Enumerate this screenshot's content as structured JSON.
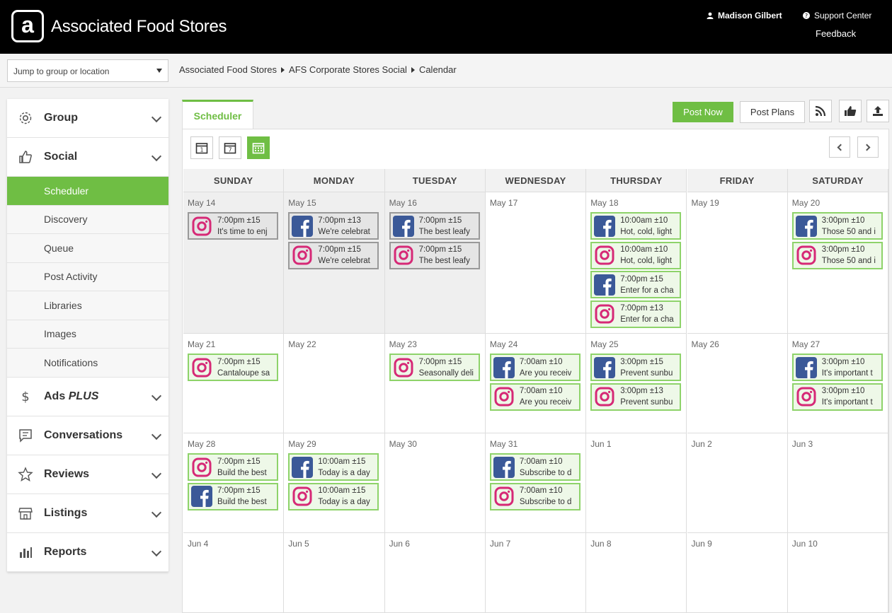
{
  "header": {
    "logo_letter": "a",
    "brand": "Associated Food Stores",
    "user_name": "Madison Gilbert",
    "support_label": "Support Center",
    "feedback_label": "Feedback"
  },
  "location_select": {
    "value": "Jump to group or location"
  },
  "breadcrumb": [
    "Associated Food Stores",
    "AFS Corporate Stores Social",
    "Calendar"
  ],
  "sidebar": {
    "group": "Group",
    "social": "Social",
    "social_items": [
      "Scheduler",
      "Discovery",
      "Queue",
      "Post Activity",
      "Libraries",
      "Images",
      "Notifications"
    ],
    "ads": "Ads",
    "ads_suffix": "PLUS",
    "conversations": "Conversations",
    "reviews": "Reviews",
    "listings": "Listings",
    "reports": "Reports"
  },
  "toolbar": {
    "tab_scheduler": "Scheduler",
    "post_now": "Post Now",
    "post_plans": "Post Plans",
    "view_day_num": "1",
    "view_week_num": "7"
  },
  "colors": {
    "accent": "#6fbe44",
    "facebook": "#3b5998",
    "instagram": "#d62976"
  },
  "calendar": {
    "days": [
      "SUNDAY",
      "MONDAY",
      "TUESDAY",
      "WEDNESDAY",
      "THURSDAY",
      "FRIDAY",
      "SATURDAY"
    ],
    "weeks": [
      [
        "May 14",
        "May 15",
        "May 16",
        "May 17",
        "May 18",
        "May 19",
        "May 20"
      ],
      [
        "May 21",
        "May 22",
        "May 23",
        "May 24",
        "May 25",
        "May 26",
        "May 27"
      ],
      [
        "May 28",
        "May 29",
        "May 30",
        "May 31",
        "Jun 1",
        "Jun 2",
        "Jun 3"
      ],
      [
        "Jun 4",
        "Jun 5",
        "Jun 6",
        "Jun 7",
        "Jun 8",
        "Jun 9",
        "Jun 10"
      ]
    ],
    "posts": [
      {
        "week": 0,
        "day": 0,
        "slot": 0,
        "network": "instagram",
        "time": "7:00pm ±15",
        "text": "It's time to enj",
        "past": true
      },
      {
        "week": 0,
        "day": 1,
        "slot": 0,
        "network": "facebook",
        "time": "7:00pm ±13",
        "text": "We're celebrat",
        "past": true
      },
      {
        "week": 0,
        "day": 1,
        "slot": 1,
        "network": "instagram",
        "time": "7:00pm ±15",
        "text": "We're celebrat",
        "past": true
      },
      {
        "week": 0,
        "day": 2,
        "slot": 0,
        "network": "facebook",
        "time": "7:00pm ±15",
        "text": "The best leafy",
        "past": true
      },
      {
        "week": 0,
        "day": 2,
        "slot": 1,
        "network": "instagram",
        "time": "7:00pm ±15",
        "text": "The best leafy",
        "past": true
      },
      {
        "week": 0,
        "day": 4,
        "slot": 0,
        "network": "facebook",
        "time": "10:00am ±10",
        "text": "Hot, cold, light",
        "past": false
      },
      {
        "week": 0,
        "day": 4,
        "slot": 1,
        "network": "instagram",
        "time": "10:00am ±10",
        "text": "Hot, cold, light",
        "past": false
      },
      {
        "week": 0,
        "day": 4,
        "slot": 2,
        "network": "facebook",
        "time": "7:00pm ±15",
        "text": "Enter for a cha",
        "past": false
      },
      {
        "week": 0,
        "day": 4,
        "slot": 3,
        "network": "instagram",
        "time": "7:00pm ±13",
        "text": "Enter for a cha",
        "past": false
      },
      {
        "week": 0,
        "day": 6,
        "slot": 0,
        "network": "facebook",
        "time": "3:00pm ±10",
        "text": "Those 50 and i",
        "past": false
      },
      {
        "week": 0,
        "day": 6,
        "slot": 1,
        "network": "instagram",
        "time": "3:00pm ±10",
        "text": "Those 50 and i",
        "past": false
      },
      {
        "week": 1,
        "day": 0,
        "slot": 0,
        "network": "instagram",
        "time": "7:00pm ±15",
        "text": "Cantaloupe sa",
        "past": false
      },
      {
        "week": 1,
        "day": 2,
        "slot": 0,
        "network": "instagram",
        "time": "7:00pm ±15",
        "text": "Seasonally deli",
        "past": false
      },
      {
        "week": 1,
        "day": 3,
        "slot": 0,
        "network": "facebook",
        "time": "7:00am ±10",
        "text": "Are you receiv",
        "past": false
      },
      {
        "week": 1,
        "day": 3,
        "slot": 1,
        "network": "instagram",
        "time": "7:00am ±10",
        "text": "Are you receiv",
        "past": false
      },
      {
        "week": 1,
        "day": 4,
        "slot": 0,
        "network": "facebook",
        "time": "3:00pm ±15",
        "text": "Prevent sunbu",
        "past": false
      },
      {
        "week": 1,
        "day": 4,
        "slot": 1,
        "network": "instagram",
        "time": "3:00pm ±13",
        "text": "Prevent sunbu",
        "past": false
      },
      {
        "week": 1,
        "day": 6,
        "slot": 0,
        "network": "facebook",
        "time": "3:00pm ±10",
        "text": "It's important t",
        "past": false
      },
      {
        "week": 1,
        "day": 6,
        "slot": 1,
        "network": "instagram",
        "time": "3:00pm ±10",
        "text": "It's important t",
        "past": false
      },
      {
        "week": 2,
        "day": 0,
        "slot": 0,
        "network": "instagram",
        "time": "7:00pm ±15",
        "text": "Build the best",
        "past": false
      },
      {
        "week": 2,
        "day": 0,
        "slot": 1,
        "network": "facebook",
        "time": "7:00pm ±15",
        "text": "Build the best",
        "past": false
      },
      {
        "week": 2,
        "day": 1,
        "slot": 0,
        "network": "facebook",
        "time": "10:00am ±15",
        "text": "Today is a day",
        "past": false
      },
      {
        "week": 2,
        "day": 1,
        "slot": 1,
        "network": "instagram",
        "time": "10:00am ±15",
        "text": "Today is a day",
        "past": false
      },
      {
        "week": 2,
        "day": 3,
        "slot": 0,
        "network": "facebook",
        "time": "7:00am ±10",
        "text": "Subscribe to d",
        "past": false
      },
      {
        "week": 2,
        "day": 3,
        "slot": 1,
        "network": "instagram",
        "time": "7:00am ±10",
        "text": "Subscribe to d",
        "past": false
      }
    ]
  }
}
